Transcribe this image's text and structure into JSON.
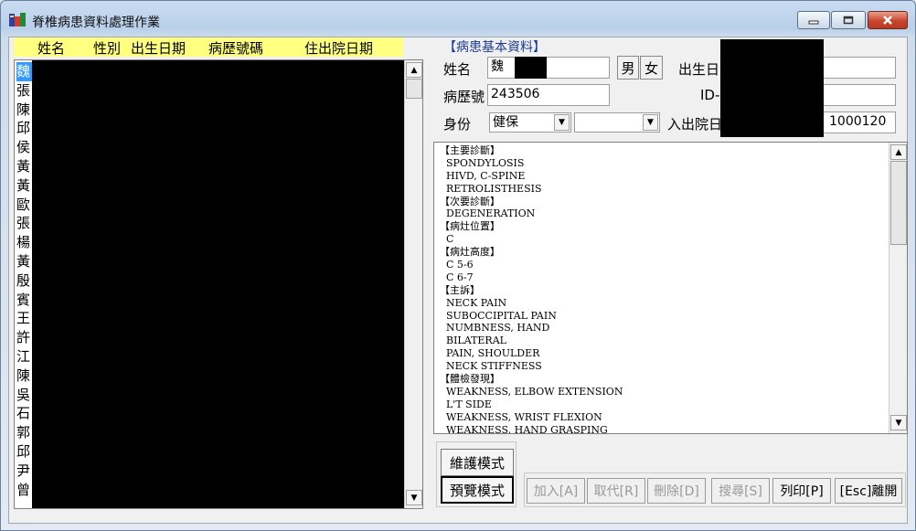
{
  "window": {
    "title": "脊椎病患資料處理作業"
  },
  "list": {
    "headers": [
      "姓名",
      "性別",
      "出生日期",
      "病歷號碼",
      "住出院日期"
    ],
    "names": [
      "魏",
      "張",
      "陳",
      "邱",
      "侯",
      "黃",
      "黃",
      "歐",
      "張",
      "楊",
      "黃",
      "殷",
      "賓",
      "王",
      "許",
      "江",
      "陳",
      "吳",
      "石",
      "郭",
      "邱",
      "尹",
      "曾"
    ]
  },
  "patient": {
    "section_title": "【病患基本資料】",
    "name_label": "姓名",
    "name_value": "魏",
    "male_label": "男",
    "female_label": "女",
    "birth_label": "出生日",
    "chart_label": "病歷號",
    "chart_value": "243506",
    "id_label": "ID-",
    "status_label": "身份",
    "status_value": "健保",
    "admit_label": "入出院日",
    "admit_value": "1000120"
  },
  "memo_lines": [
    "【主要診斷】",
    "  SPONDYLOSIS",
    "  HIVD, C-SPINE",
    "  RETROLISTHESIS",
    "【次要診斷】",
    "  DEGENERATION",
    "【病灶位置】",
    "  C",
    "【病灶高度】",
    "  C 5-6",
    "  C 6-7",
    "【主訴】",
    "  NECK PAIN",
    "  SUBOCCIPITAL PAIN",
    "  NUMBNESS, HAND",
    "  BILATERAL",
    "  PAIN, SHOULDER",
    "  NECK STIFFNESS",
    "【體檢發現】",
    "  WEAKNESS, ELBOW EXTENSION",
    "  L'T SIDE",
    "  WEAKNESS, WRIST FLEXION",
    "  WEAKNESS, HAND GRASPING"
  ],
  "modes": {
    "maintain": "維護模式",
    "preview": "預覽模式"
  },
  "actions": {
    "add": "加入[A]",
    "replace": "取代[R]",
    "delete": "刪除[D]",
    "search": "搜尋[S]",
    "print": "列印[P]",
    "exit": "[Esc]離開"
  }
}
